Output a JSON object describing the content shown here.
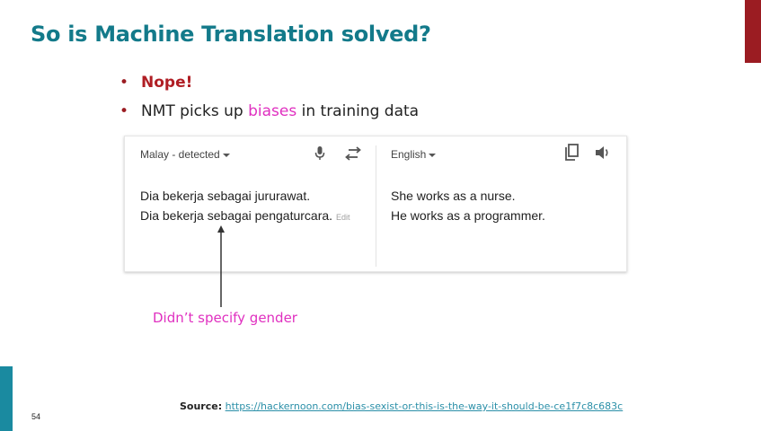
{
  "slide": {
    "title": "So is Machine Translation solved?",
    "page_number": "54"
  },
  "bullets": {
    "b1": "Nope!",
    "b2_before": "NMT picks up ",
    "b2_highlight": "biases",
    "b2_after": " in training data"
  },
  "translator": {
    "source_lang": "Malay - detected",
    "target_lang": "English",
    "source_lines": [
      "Dia bekerja sebagai jururawat.",
      "Dia bekerja sebagai pengaturcara."
    ],
    "edit_label": "Edit",
    "target_lines": [
      "She works as a nurse.",
      "He works as a programmer."
    ]
  },
  "annotation": "Didn’t specify gender",
  "source": {
    "label": "Source:",
    "url": "https://hackernoon.com/bias-sexist-or-this-is-the-way-it-should-be-ce1f7c8c683c"
  },
  "colors": {
    "title": "#137a8a",
    "accent_red": "#9b1c22",
    "highlight_pink": "#e030c0",
    "side_bar": "#1a8aa0"
  },
  "icons": [
    "microphone-icon",
    "swap-icon",
    "copy-icon",
    "speaker-icon"
  ]
}
